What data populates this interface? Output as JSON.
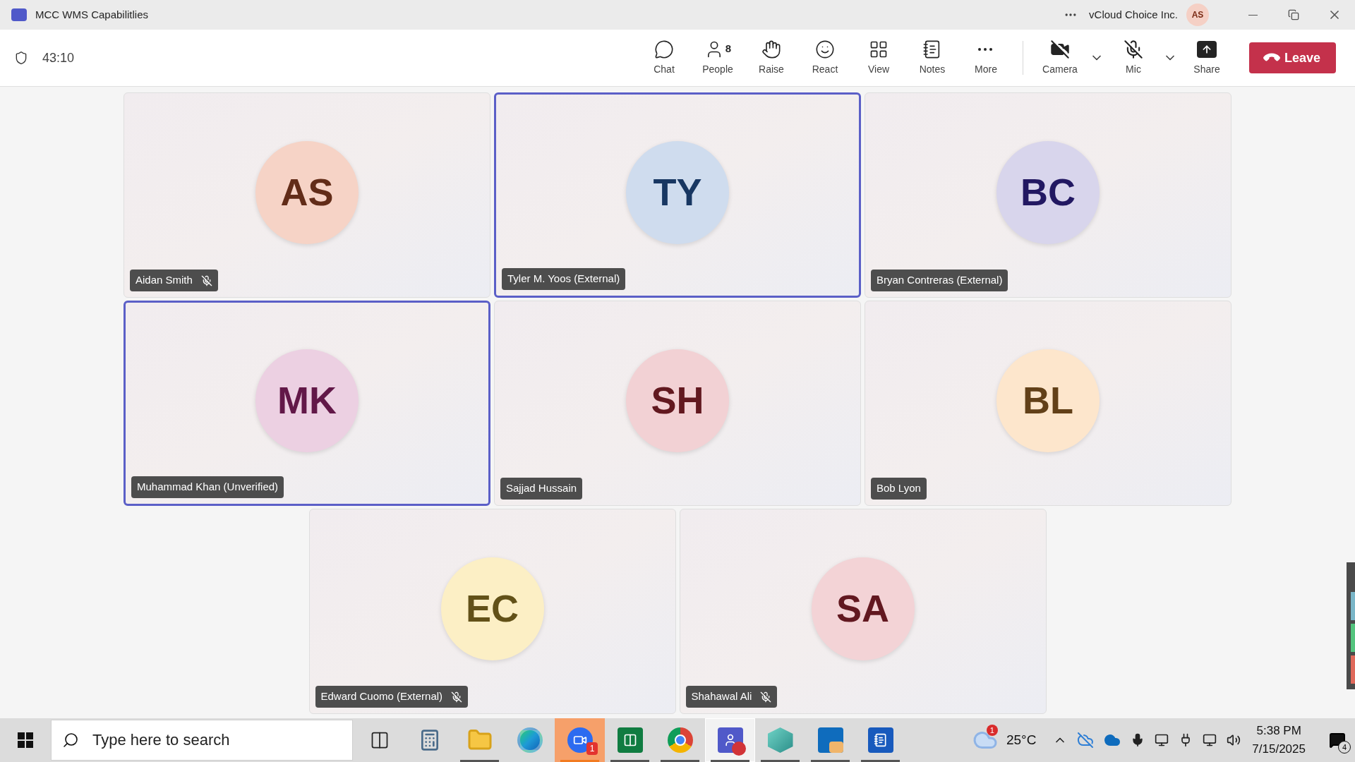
{
  "window": {
    "title": "MCC WMS Capabilitlies",
    "account": "vCloud Choice Inc.",
    "avatar_initials": "AS"
  },
  "meeting": {
    "timer": "43:10"
  },
  "toolbar": [
    {
      "kind": "chat",
      "label": "Chat"
    },
    {
      "kind": "people",
      "label": "People",
      "count": "8"
    },
    {
      "kind": "raise",
      "label": "Raise"
    },
    {
      "kind": "react",
      "label": "React"
    },
    {
      "kind": "view",
      "label": "View"
    },
    {
      "kind": "notes",
      "label": "Notes"
    },
    {
      "kind": "more",
      "label": "More"
    },
    {
      "kind": "camera",
      "label": "Camera",
      "on": false
    },
    {
      "kind": "mic",
      "label": "Mic",
      "on": false
    },
    {
      "kind": "share",
      "label": "Share"
    }
  ],
  "leave_button": "Leave",
  "participants": [
    {
      "initials": "AS",
      "name": "Aidan Smith",
      "muted": true,
      "speaking": false,
      "color": "#f6d3c6"
    },
    {
      "initials": "TY",
      "name": "Tyler M. Yoos (External)",
      "muted": false,
      "speaking": true,
      "color": "#cfdcee"
    },
    {
      "initials": "BC",
      "name": "Bryan Contreras (External)",
      "muted": false,
      "speaking": false,
      "color": "#d8d5ec"
    },
    {
      "initials": "MK",
      "name": "Muhammad Khan (Unverified)",
      "muted": false,
      "speaking": true,
      "color": "#ecd0e2"
    },
    {
      "initials": "SH",
      "name": "Sajjad Hussain",
      "muted": false,
      "speaking": false,
      "color": "#f2d1d4"
    },
    {
      "initials": "BL",
      "name": "Bob Lyon",
      "muted": false,
      "speaking": false,
      "color": "#fde6cc"
    },
    {
      "initials": "EC",
      "name": "Edward Cuomo (External)",
      "muted": true,
      "speaking": false,
      "color": "#fcefc5"
    },
    {
      "initials": "SA",
      "name": "Shahawal Ali",
      "muted": true,
      "speaking": false,
      "color": "#f3d3d6"
    }
  ],
  "taskbar": {
    "search": {
      "placeholder": "Type here to search"
    },
    "apps": [
      {
        "kind": "taskview",
        "open": false,
        "selected": false,
        "attention": false
      },
      {
        "kind": "calculator",
        "open": false,
        "selected": false,
        "attention": false
      },
      {
        "kind": "explorer",
        "open": true,
        "selected": false,
        "attention": false
      },
      {
        "kind": "edge",
        "open": false,
        "selected": false,
        "attention": false
      },
      {
        "kind": "zoom",
        "open": true,
        "selected": false,
        "attention": true,
        "badge": "1"
      },
      {
        "kind": "excel",
        "open": true,
        "selected": false,
        "attention": false
      },
      {
        "kind": "chrome",
        "open": true,
        "selected": false,
        "attention": false
      },
      {
        "kind": "teams",
        "open": true,
        "selected": true,
        "attention": false
      },
      {
        "kind": "gem",
        "open": true,
        "selected": false,
        "attention": false
      },
      {
        "kind": "outlook",
        "open": true,
        "selected": false,
        "attention": false
      },
      {
        "kind": "word",
        "open": true,
        "selected": false,
        "attention": false
      }
    ],
    "weather": {
      "badge": "1",
      "temperature": "25°C"
    },
    "clock": {
      "time": "5:38 PM",
      "date": "7/15/2025"
    },
    "notifications": {
      "count": "4"
    }
  }
}
